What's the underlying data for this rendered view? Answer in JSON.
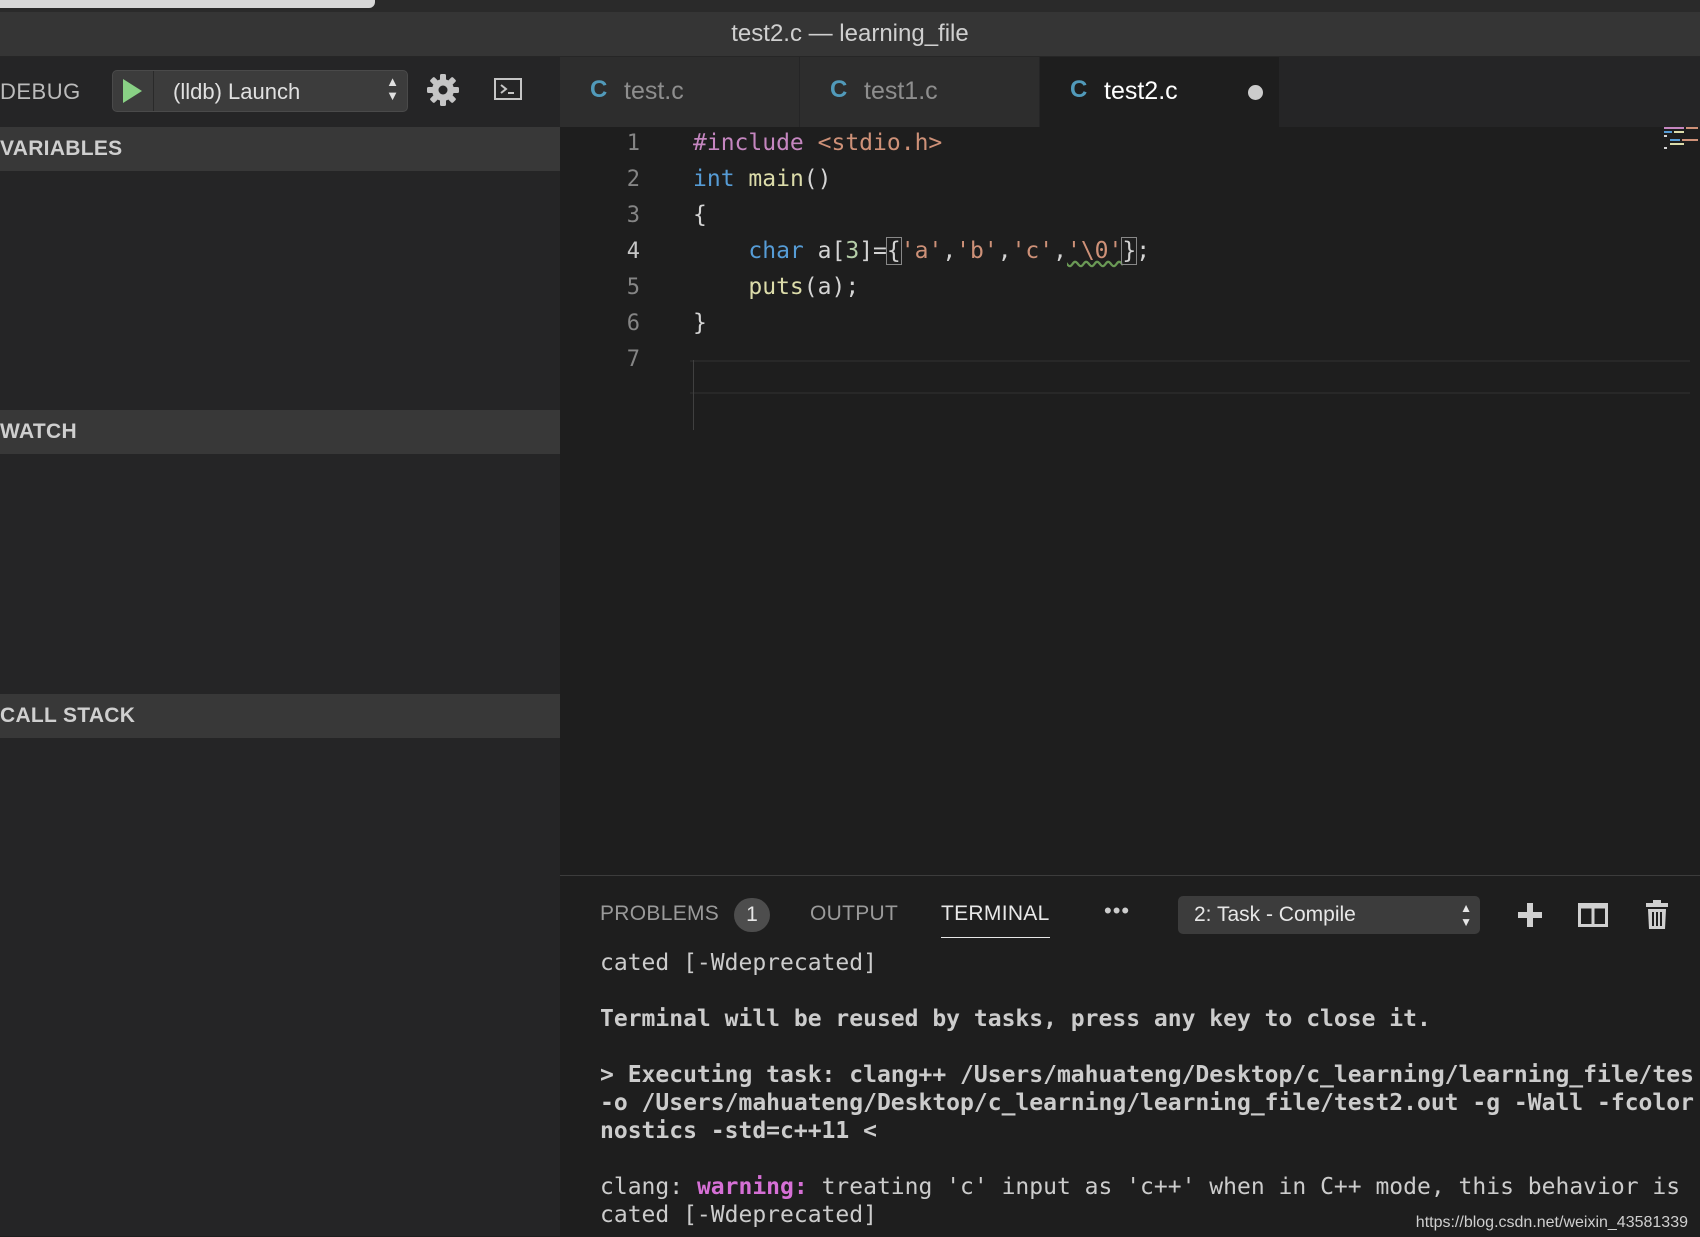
{
  "window": {
    "title": "test2.c — learning_file"
  },
  "debug": {
    "label": "DEBUG",
    "config": "(lldb) Launch",
    "sections": [
      "VARIABLES",
      "WATCH",
      "CALL STACK"
    ]
  },
  "tabs": [
    {
      "icon": "C",
      "name": "test.c"
    },
    {
      "icon": "C",
      "name": "test1.c"
    },
    {
      "icon": "C",
      "name": "test2.c"
    }
  ],
  "editor": {
    "line_numbers": [
      "1",
      "2",
      "3",
      "4",
      "5",
      "6",
      "7"
    ],
    "tokens": {
      "l1_dir": "#include",
      "l1_hdr": "<stdio.h>",
      "l2_type": "int",
      "l2_fn": "main",
      "l2_rest": "()",
      "l3": "{",
      "l4_type": "char",
      "l4_a": "a[",
      "l4_num": "3",
      "l4_eq": "]=",
      "l4_ob": "{",
      "l4_ca": "'a'",
      "l4_cm1": ",",
      "l4_cb": "'b'",
      "l4_cm2": ",",
      "l4_cc": "'c'",
      "l4_cm3": ",",
      "l4_c0": "'\\0'",
      "l4_cb2": "}",
      "l4_semi": ";",
      "l5_fn": "puts",
      "l5_rest": "(a);",
      "l6": "}"
    }
  },
  "panel": {
    "tabs": [
      "PROBLEMS",
      "OUTPUT",
      "TERMINAL"
    ],
    "problems_count": "1",
    "more": "•••",
    "task": "2: Task - Compile",
    "terminal": {
      "l1": "cated [-Wdeprecated]",
      "l2": "Terminal will be reused by tasks, press any key to close it.",
      "l3": "> Executing task: clang++ /Users/mahuateng/Desktop/c_learning/learning_file/tes",
      "l4": "-o /Users/mahuateng/Desktop/c_learning/learning_file/test2.out -g -Wall -fcolor",
      "l5": "nostics -std=c++11 <",
      "l6_pre": "clang: ",
      "l6_warn": "warning:",
      "l6_post": " treating 'c' input as 'c++' when in C++ mode, this behavior is",
      "l7": "cated [-Wdeprecated]"
    }
  },
  "watermark": "https://blog.csdn.net/weixin_43581339",
  "colors": {
    "play": "#89d185",
    "c_icon": "#519aba",
    "keyword": "#569cd6",
    "string": "#ce9178",
    "directive": "#c586c0",
    "function": "#dcdcaa",
    "number": "#b5cea8",
    "warning": "#d670d6"
  },
  "icons": [
    "play-icon",
    "gear-icon",
    "debug-console-icon",
    "c-file-icon",
    "unsaved-dot-icon",
    "plus-icon",
    "split-terminal-icon",
    "trash-icon",
    "select-arrows-icon"
  ]
}
